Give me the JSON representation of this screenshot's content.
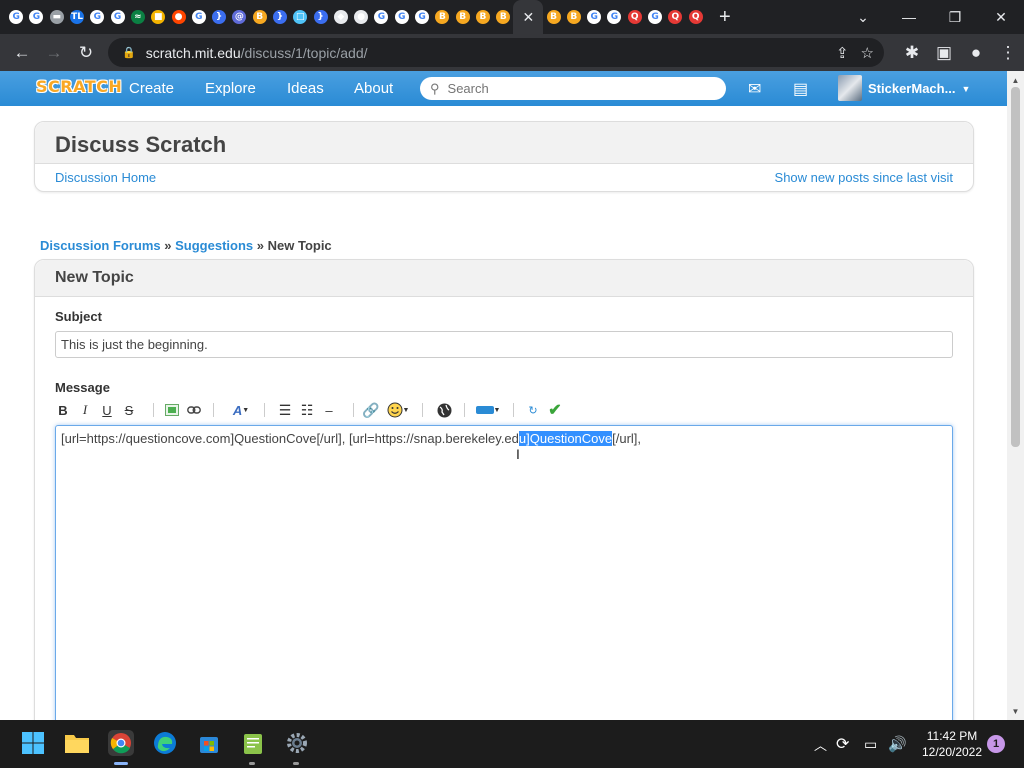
{
  "browser": {
    "tab_favicons": [
      {
        "name": "google-favicon",
        "glyph": "G",
        "color": "#4285f4"
      },
      {
        "name": "google-favicon",
        "glyph": "G",
        "color": "#4285f4"
      },
      {
        "name": "monitor-favicon",
        "glyph": "▬",
        "color": "#9aa0a6"
      },
      {
        "name": "tl-favicon",
        "glyph": "TL",
        "color": "#1a73e8"
      },
      {
        "name": "google-favicon",
        "glyph": "G",
        "color": "#4285f4"
      },
      {
        "name": "google-favicon",
        "glyph": "G",
        "color": "#4285f4"
      },
      {
        "name": "wave-favicon",
        "glyph": "≈",
        "color": "#0b8043"
      },
      {
        "name": "square-favicon",
        "glyph": "■",
        "color": "#f4b400"
      },
      {
        "name": "reddit-favicon",
        "glyph": "●",
        "color": "#ff4500"
      },
      {
        "name": "google-favicon",
        "glyph": "G",
        "color": "#4285f4"
      },
      {
        "name": "braces-favicon",
        "glyph": "}",
        "color": "#3b6ef0"
      },
      {
        "name": "at-favicon",
        "glyph": "@",
        "color": "#5f6bd8"
      },
      {
        "name": "b-favicon",
        "glyph": "B",
        "color": "#f6a821"
      },
      {
        "name": "braces-favicon",
        "glyph": "}",
        "color": "#3b6ef0"
      },
      {
        "name": "chat-favicon",
        "glyph": "□",
        "color": "#4fc3f7"
      },
      {
        "name": "braces-favicon",
        "glyph": "}",
        "color": "#3b6ef0"
      },
      {
        "name": "roblox-favicon",
        "glyph": "◆",
        "color": "#e8eaed"
      },
      {
        "name": "github-favicon",
        "glyph": "●",
        "color": "#e8eaed"
      },
      {
        "name": "google-favicon",
        "glyph": "G",
        "color": "#4285f4"
      },
      {
        "name": "google-favicon",
        "glyph": "G",
        "color": "#4285f4"
      },
      {
        "name": "google-favicon",
        "glyph": "G",
        "color": "#4285f4"
      },
      {
        "name": "b-favicon",
        "glyph": "B",
        "color": "#f6a821"
      },
      {
        "name": "b-favicon",
        "glyph": "B",
        "color": "#f6a821"
      },
      {
        "name": "b-favicon",
        "glyph": "B",
        "color": "#f6a821"
      },
      {
        "name": "b-favicon",
        "glyph": "B",
        "color": "#f6a821"
      }
    ],
    "active_tab_close": "✕",
    "tab_favicons_after": [
      {
        "name": "b-favicon",
        "glyph": "B",
        "color": "#f6a821"
      },
      {
        "name": "b-favicon",
        "glyph": "B",
        "color": "#f6a821"
      },
      {
        "name": "google-favicon",
        "glyph": "G",
        "color": "#4285f4"
      },
      {
        "name": "google-favicon",
        "glyph": "G",
        "color": "#4285f4"
      },
      {
        "name": "q-favicon",
        "glyph": "Q",
        "color": "#e53935"
      },
      {
        "name": "google-favicon",
        "glyph": "G",
        "color": "#4285f4"
      },
      {
        "name": "q-favicon",
        "glyph": "Q",
        "color": "#e53935"
      },
      {
        "name": "q-favicon",
        "glyph": "Q",
        "color": "#e53935"
      }
    ],
    "new_tab": "+",
    "url_host": "scratch.mit.edu",
    "url_path": "/discuss/1/topic/add/"
  },
  "nav": {
    "logo": "SCRATCH",
    "create": "Create",
    "explore": "Explore",
    "ideas": "Ideas",
    "about": "About",
    "search_placeholder": "Search",
    "username": "StickerMach..."
  },
  "page": {
    "title": "Discuss Scratch",
    "discussion_home": "Discussion Home",
    "show_new_posts": "Show new posts since last visit",
    "breadcrumb": {
      "forums": "Discussion Forums",
      "sep1": "»",
      "category": "Suggestions",
      "sep2": "»",
      "current": "New Topic"
    },
    "section_title": "New Topic",
    "subject_label": "Subject",
    "subject_value": "This is just the beginning.",
    "message_label": "Message",
    "message_before": "[url=https://questioncove.com]QuestionCove[/url], [url=https://snap.berekeley.ed",
    "message_selected": "u]QuestionCove",
    "message_after": "[/url],"
  },
  "editor_tools": {
    "bold": "B",
    "italic": "I",
    "underline": "U",
    "strike": "S"
  },
  "taskbar": {
    "time": "11:42 PM",
    "date": "12/20/2022",
    "notifications": "1"
  }
}
